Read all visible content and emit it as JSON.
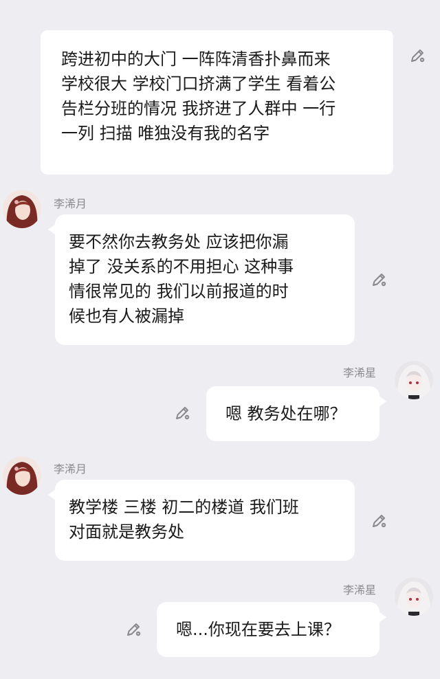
{
  "narration": {
    "text": "跨进初中的大门 一阵阵清香扑鼻而来\n学校很大 学校门口挤满了学生 看着公\n告栏分班的情况 我挤进了人群中 一行\n一列 扫描 唯独没有我的名字"
  },
  "messages": [
    {
      "sender": "李浠月",
      "text": "要不然你去教务处 应该把你漏\n掉了 没关系的不用担心 这种事\n情很常见的 我们以前报道的时\n候也有人被漏掉"
    },
    {
      "sender": "李浠星",
      "text": "嗯 教务处在哪？"
    },
    {
      "sender": "李浠月",
      "text": "教学楼 三楼 初二的楼道 我们班\n对面就是教务处"
    },
    {
      "sender": "李浠星",
      "text": "嗯...你现在要去上课？"
    }
  ],
  "icons": {
    "edit": "pencil-edit-icon",
    "avatar_left": "avatar-red-hair",
    "avatar_right": "avatar-white-hair"
  },
  "colors": {
    "background": "#ededf2",
    "bubble": "#ffffff",
    "text": "#1a1a1a",
    "name": "#8a8a8e"
  }
}
